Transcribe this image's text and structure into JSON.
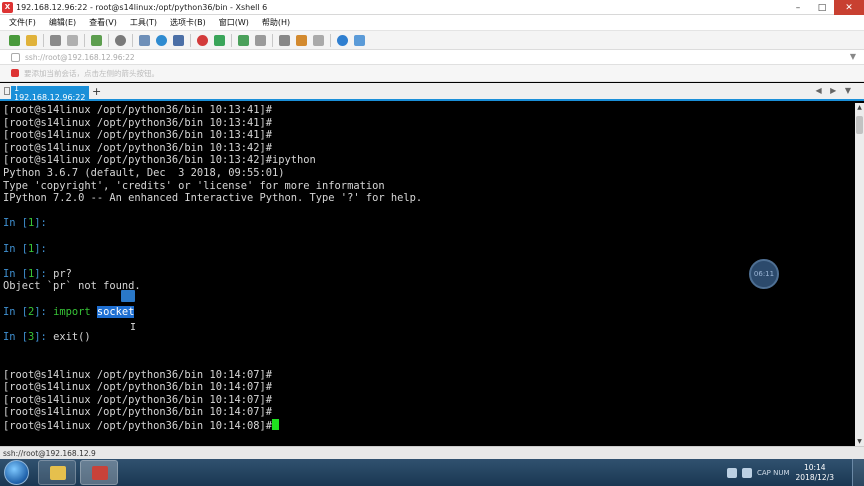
{
  "window": {
    "title": "192.168.12.96:22 - root@s14linux:/opt/python36/bin - Xshell 6",
    "app_icon": "xshell-icon",
    "controls": {
      "minimize": "–",
      "maximize": "□",
      "close": "✕"
    }
  },
  "menu": [
    "文件(F)",
    "编辑(E)",
    "查看(V)",
    "工具(T)",
    "选项卡(B)",
    "窗口(W)",
    "帮助(H)"
  ],
  "toolbar_icons": [
    "new-session-icon",
    "open-folder-icon",
    "link-icon",
    "unlink-icon",
    "new-tab-icon",
    "search-icon",
    "transfer-icon",
    "globe-icon",
    "font-icon",
    "record-icon",
    "script-icon",
    "fullscreen-icon",
    "lock-icon",
    "keyboard-icon",
    "compose-icon",
    "layout-icon",
    "help-icon",
    "chat-icon"
  ],
  "address": {
    "text": "ssh://root@192.168.12.96:22",
    "arrow": "▼"
  },
  "hint": {
    "text": "要添加当前会话，点击左侧的箭头按钮。"
  },
  "tabs": [
    {
      "label": "1 192.168.12.96:22"
    }
  ],
  "tab_add": "+",
  "tab_nav": "◀ ▶ ▼",
  "terminal_lines": [
    [
      {
        "t": "[root@s14linux /opt/python36/bin 10:13:41]#"
      }
    ],
    [
      {
        "t": "[root@s14linux /opt/python36/bin 10:13:41]#"
      }
    ],
    [
      {
        "t": "[root@s14linux /opt/python36/bin 10:13:41]#"
      }
    ],
    [
      {
        "t": "[root@s14linux /opt/python36/bin 10:13:42]#"
      }
    ],
    [
      {
        "t": "[root@s14linux /opt/python36/bin 10:13:42]#ipython"
      }
    ],
    [
      {
        "t": "Python 3.6.7 (default, Dec  3 2018, 09:55:01)"
      }
    ],
    [
      {
        "t": "Type 'copyright', 'credits' or 'license' for more information"
      }
    ],
    [
      {
        "t": "IPython 7.2.0 -- An enhanced Interactive Python. Type '?' for help."
      }
    ],
    [],
    [
      {
        "t": "In [",
        "c": "c-blue"
      },
      {
        "t": "1",
        "c": "c-green"
      },
      {
        "t": "]: ",
        "c": "c-blue"
      }
    ],
    [],
    [
      {
        "t": "In [",
        "c": "c-blue"
      },
      {
        "t": "1",
        "c": "c-green"
      },
      {
        "t": "]: ",
        "c": "c-blue"
      }
    ],
    [],
    [
      {
        "t": "In [",
        "c": "c-blue"
      },
      {
        "t": "1",
        "c": "c-green"
      },
      {
        "t": "]: ",
        "c": "c-blue"
      },
      {
        "t": "pr?"
      }
    ],
    [
      {
        "t": "Object `pr` not found."
      }
    ],
    [],
    [
      {
        "t": "In [",
        "c": "c-blue"
      },
      {
        "t": "2",
        "c": "c-green"
      },
      {
        "t": "]: ",
        "c": "c-blue"
      },
      {
        "t": "import",
        "c": "c-green"
      },
      {
        "t": " "
      },
      {
        "t": "socket",
        "c": "c-sel"
      }
    ],
    [],
    [
      {
        "t": "In [",
        "c": "c-blue"
      },
      {
        "t": "3",
        "c": "c-green"
      },
      {
        "t": "]: ",
        "c": "c-blue"
      },
      {
        "t": "exit()"
      }
    ],
    [],
    [],
    [
      {
        "t": "[root@s14linux /opt/python36/bin 10:14:07]#"
      }
    ],
    [
      {
        "t": "[root@s14linux /opt/python36/bin 10:14:07]#"
      }
    ],
    [
      {
        "t": "[root@s14linux /opt/python36/bin 10:14:07]#"
      }
    ],
    [
      {
        "t": "[root@s14linux /opt/python36/bin 10:14:07]#"
      }
    ],
    [
      {
        "t": "[root@s14linux /opt/python36/bin 10:14:08]#"
      },
      {
        "t": "",
        "c": "cursor"
      }
    ]
  ],
  "timer_badge": "06:11",
  "scrollbar": {
    "up": "▲",
    "down": "▼"
  },
  "status": {
    "text": "ssh://root@192.168.12.9"
  },
  "taskbar": {
    "tray": {
      "caps": "CAP  NUM",
      "time": "10:14",
      "date": "2018/12/3"
    }
  },
  "colors": {
    "accent": "#1a8fd8",
    "prompt_blue": "#3f8fcf",
    "prompt_green": "#37c437",
    "selection": "#1e6fd2",
    "cursor": "#1fe01f"
  }
}
